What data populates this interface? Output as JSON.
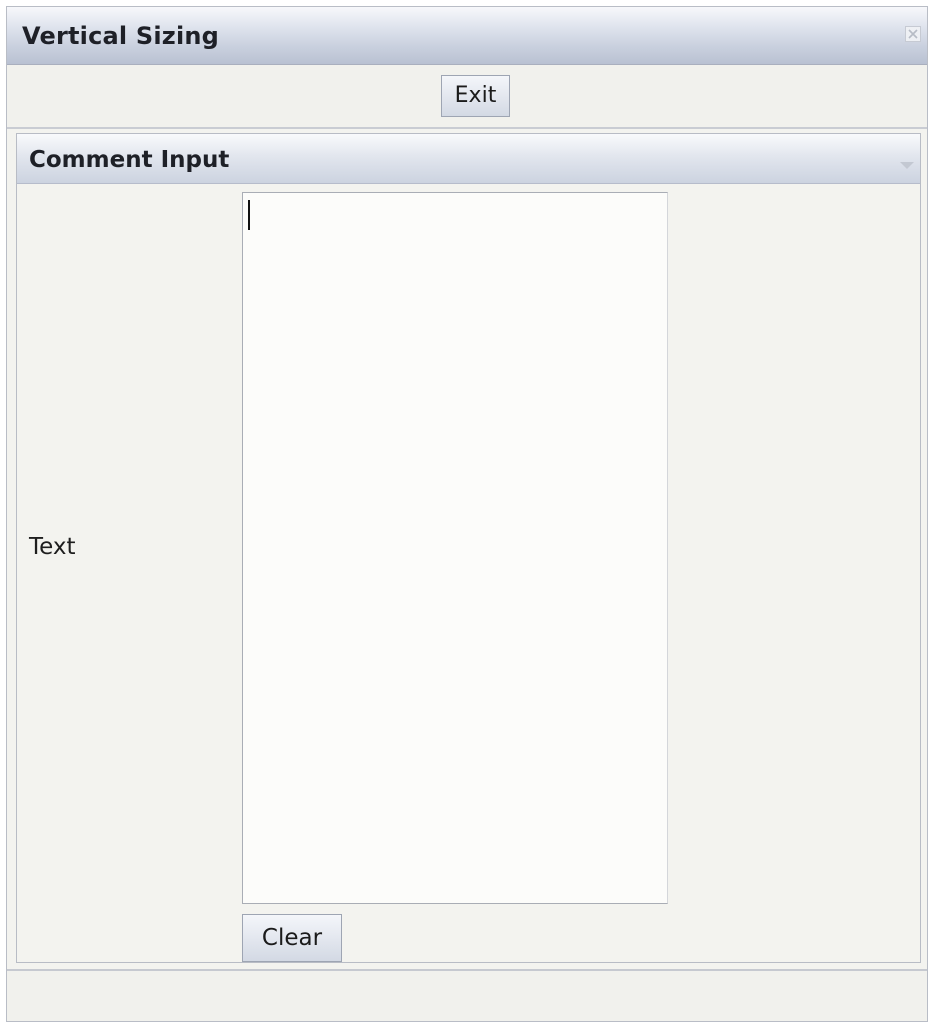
{
  "window": {
    "title": "Vertical Sizing",
    "close_icon": "close-icon"
  },
  "toolbar": {
    "exit_label": "Exit"
  },
  "panel": {
    "title": "Comment Input",
    "collapse_icon": "chevron-down-icon",
    "text_label": "Text",
    "text_value": "",
    "clear_label": "Clear"
  },
  "colors": {
    "header_gradient_top": "#f7f8fb",
    "header_gradient_bottom": "#b9c1d2",
    "background": "#f3f3ef",
    "input_background": "#fcfcfa"
  }
}
